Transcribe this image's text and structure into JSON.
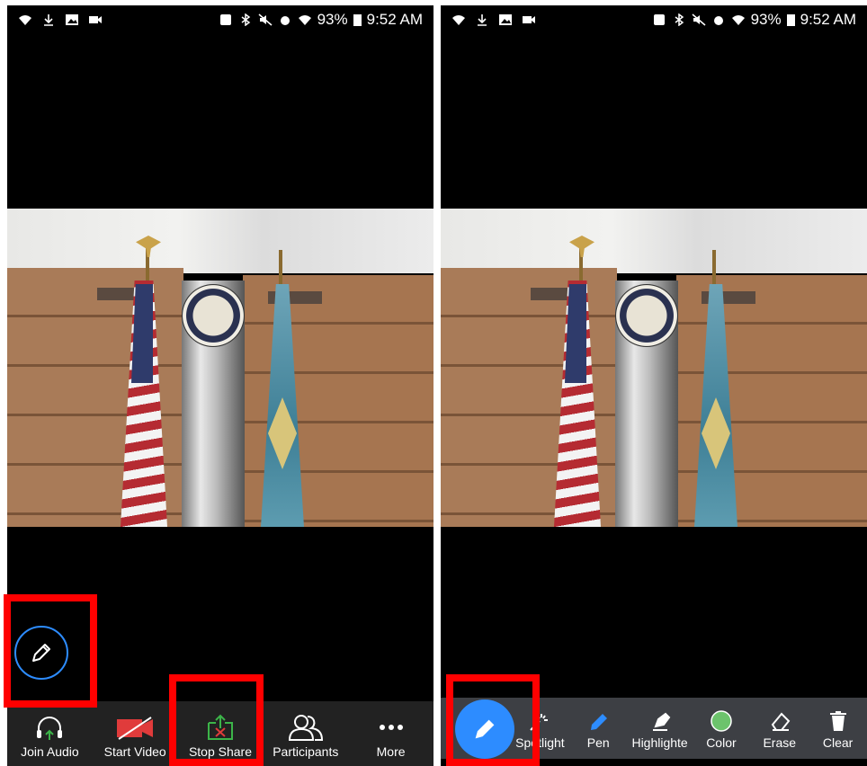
{
  "status_bar": {
    "battery_percent": "93%",
    "time": "9:52 AM"
  },
  "left_screen": {
    "toolbar": [
      {
        "label": "Join Audio",
        "icon": "headphones-icon"
      },
      {
        "label": "Start Video",
        "icon": "video-off-icon"
      },
      {
        "label": "Stop Share",
        "icon": "stop-share-icon"
      },
      {
        "label": "Participants",
        "icon": "participants-icon"
      },
      {
        "label": "More",
        "icon": "more-dots-icon"
      }
    ],
    "annotate_button_icon": "pencil-icon"
  },
  "right_screen": {
    "annotation_tools": [
      {
        "label": "Spotlight",
        "icon": "spotlight-icon"
      },
      {
        "label": "Pen",
        "icon": "pen-icon"
      },
      {
        "label": "Highlighte",
        "icon": "highlighter-icon"
      },
      {
        "label": "Color",
        "icon": "color-dot-icon"
      },
      {
        "label": "Erase",
        "icon": "eraser-icon"
      },
      {
        "label": "Clear",
        "icon": "trash-icon"
      }
    ],
    "annotate_button_icon": "pencil-icon"
  },
  "colors": {
    "accent": "#2d8cff",
    "stop_share_green": "#3cb449",
    "video_off_red": "#e03b3b",
    "highlight_red": "#ff0000",
    "color_tool_green": "#6cc36c"
  }
}
